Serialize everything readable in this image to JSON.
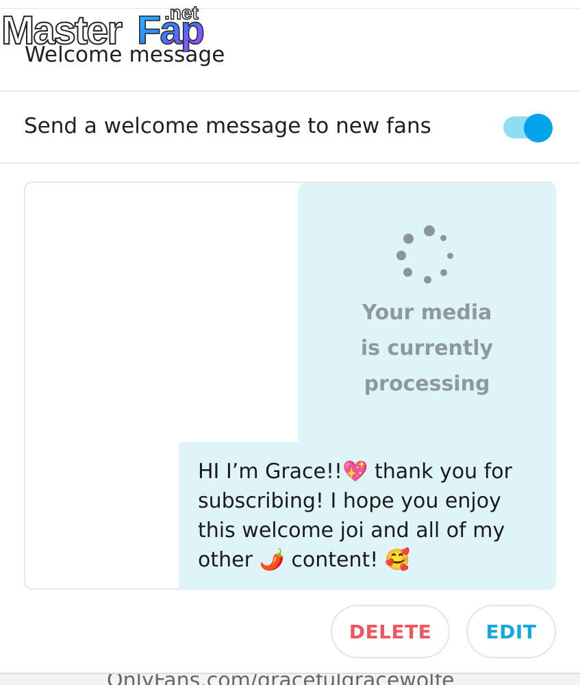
{
  "watermark": {
    "brand_main": "Master",
    "brand_accent": "Fap",
    "brand_tld": ".net"
  },
  "header": {
    "title": "Welcome message"
  },
  "setting": {
    "label": "Send a welcome message to new fans",
    "toggle_on": true
  },
  "message": {
    "media_status": "Your media\nis currently\nprocessing",
    "text": "HI I’m Grace!!💖 thank you for subscribing! I hope you enjoy this welcome joi and all of my other 🌶️ content! 🥰"
  },
  "actions": {
    "delete_label": "DELETE",
    "edit_label": "EDIT"
  },
  "footer": {
    "url_text": "OnlyFans.com/gracefulgracewolfe"
  },
  "colors": {
    "accent": "#00a3ec",
    "toggle_track": "#8fdcf5",
    "bubble_bg": "#dff4f9",
    "delete": "#f0565e",
    "edit": "#14a7e0",
    "muted_text": "#8e999d"
  },
  "icons": {
    "spinner": "loading-spinner-icon"
  }
}
